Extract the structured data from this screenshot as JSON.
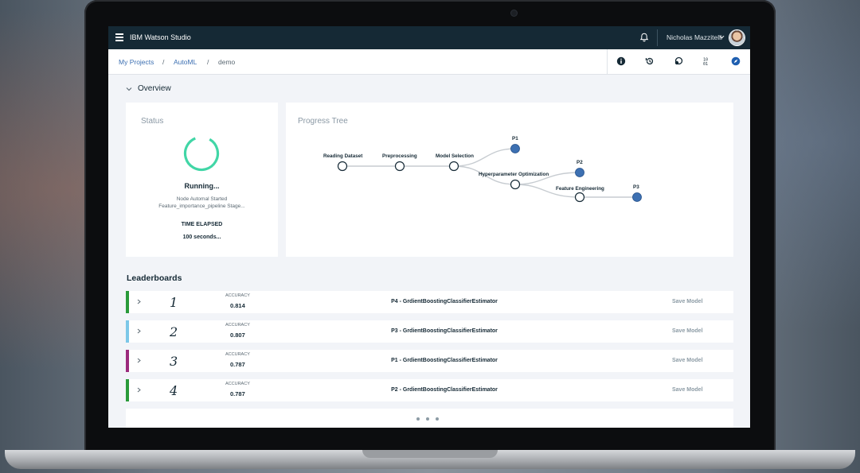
{
  "app": {
    "title": "IBM Watson Studio",
    "user_name": "Nicholas Mazzitelli"
  },
  "breadcrumb": [
    "My Projects",
    "/",
    "AutoML",
    "/",
    "demo"
  ],
  "toolbar_icons": [
    "info-icon",
    "history-icon",
    "deploy-icon",
    "binary-data-icon",
    "compass-icon"
  ],
  "overview": {
    "title": "Overview"
  },
  "status": {
    "title": "Status",
    "state": "Running...",
    "message_line1": "Node Automal Started",
    "message_line2": "Feature_importance_pipeline Stage...",
    "elapsed_label": "TIME ELAPSED",
    "elapsed_value": "100 seconds..."
  },
  "progress_tree": {
    "title": "Progress Tree",
    "nodes": {
      "reading": "Reading Dataset",
      "preprocessing": "Preprocessing",
      "model_selection": "Model Selection",
      "hyperparameter": "Hyperparameter Optimization",
      "feature_engineering": "Feature Engineering",
      "p1": "P1",
      "p2": "P2",
      "p3": "P3"
    },
    "colors": {
      "node_fill": "#3d70b2",
      "node_stroke": "#152935",
      "edge": "#c7ccd1"
    }
  },
  "leaderboards": {
    "title": "Leaderboards",
    "accuracy_label": "ACCURACY",
    "save_label": "Save Model",
    "rows": [
      {
        "rank": "1",
        "accuracy": "0.814",
        "model": "P4 - GrdientBoostingClassifierEstimator",
        "color": "#2a9a3a"
      },
      {
        "rank": "2",
        "accuracy": "0.807",
        "model": "P3 - GrdientBoostingClassifierEstimator",
        "color": "#7cc7e8"
      },
      {
        "rank": "3",
        "accuracy": "0.787",
        "model": "P1 - GrdientBoostingClassifierEstimator",
        "color": "#9b2a7c"
      },
      {
        "rank": "4",
        "accuracy": "0.787",
        "model": "P2 - GrdientBoostingClassifierEstimator",
        "color": "#2a9a3a"
      }
    ]
  },
  "pager": {
    "dots": 3
  },
  "colors": {
    "topbar": "#152935",
    "accent": "#3d70b2",
    "spinner": "#41d6a6",
    "background": "#f2f4f8"
  }
}
